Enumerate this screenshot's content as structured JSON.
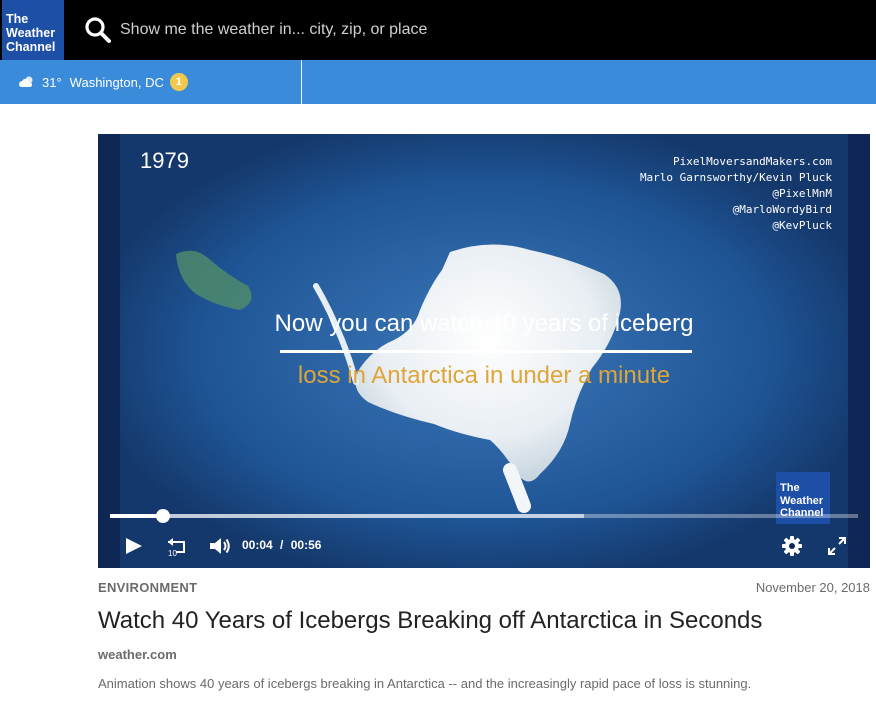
{
  "header": {
    "logo_lines": [
      "The",
      "Weather",
      "Channel"
    ],
    "search_placeholder": "Show me the weather in... city, zip, or place"
  },
  "location_bar": {
    "temperature": "31°",
    "location": "Washington, DC",
    "alert_count": "1",
    "weather_icon": "partly-cloudy-icon"
  },
  "video": {
    "year_overlay": "1979",
    "credits": [
      "PixelMoversandMakers.com",
      "Marlo Garnsworthy/Kevin Pluck",
      "@PixelMnM",
      "@MarloWordyBird",
      "@KevPluck"
    ],
    "headline_line1": "Now you can watch 40 years of iceberg",
    "headline_line2": "loss in Antarctica in under a minute",
    "watermark_lines": [
      "The",
      "Weather",
      "Channel"
    ],
    "current_time": "00:04",
    "time_separator": "/",
    "duration": "00:56",
    "progress_fraction": 0.071,
    "buffered_fraction": 0.634,
    "colors": {
      "headline_accent": "#e0a538",
      "ocean": "#1b4f93"
    }
  },
  "article": {
    "category": "ENVIRONMENT",
    "date": "November 20, 2018",
    "title": "Watch 40 Years of Icebergs Breaking off Antarctica in Seconds",
    "source": "weather.com",
    "description": "Animation shows 40 years of icebergs breaking in Antarctica -- and the increasingly rapid pace of loss is stunning."
  },
  "colors": {
    "header_bg": "#000000",
    "brand_blue": "#1c4fa5",
    "location_bar_bg": "#3a8bd9",
    "badge": "#f2c94c"
  }
}
